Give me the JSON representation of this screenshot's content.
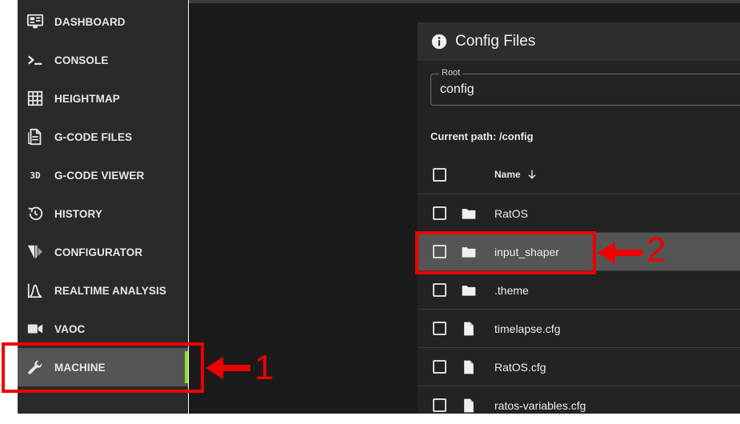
{
  "sidebar": {
    "items": [
      {
        "label": "DASHBOARD",
        "icon": "monitor-dashboard-icon"
      },
      {
        "label": "CONSOLE",
        "icon": "console-icon"
      },
      {
        "label": "HEIGHTMAP",
        "icon": "grid-icon"
      },
      {
        "label": "G-CODE FILES",
        "icon": "file-document-icon"
      },
      {
        "label": "G-CODE VIEWER",
        "icon": "3d-icon"
      },
      {
        "label": "HISTORY",
        "icon": "history-icon"
      },
      {
        "label": "CONFIGURATOR",
        "icon": "ratos-logo-icon"
      },
      {
        "label": "REALTIME ANALYSIS",
        "icon": "chart-bell-curve-icon"
      },
      {
        "label": "VAOC",
        "icon": "video-camera-icon"
      },
      {
        "label": "MACHINE",
        "icon": "wrench-icon",
        "active": true
      }
    ],
    "glyph_3d": "3D"
  },
  "config_panel": {
    "title": "Config Files",
    "root_label": "Root",
    "root_value": "config",
    "current_path": "Current path: /config",
    "column_name": "Name",
    "rows": [
      {
        "name": "RatOS",
        "type": "folder"
      },
      {
        "name": "input_shaper",
        "type": "folder",
        "highlighted": true
      },
      {
        "name": ".theme",
        "type": "folder"
      },
      {
        "name": "timelapse.cfg",
        "type": "file"
      },
      {
        "name": "RatOS.cfg",
        "type": "file"
      },
      {
        "name": "ratos-variables.cfg",
        "type": "file"
      }
    ]
  },
  "annotations": {
    "label_1": "1",
    "label_2": "2",
    "color": "#ee0000"
  },
  "colors": {
    "accent_active": "#8bdc2a",
    "sidebar_bg": "#2a2a2a",
    "highlight_bg": "#555555"
  }
}
